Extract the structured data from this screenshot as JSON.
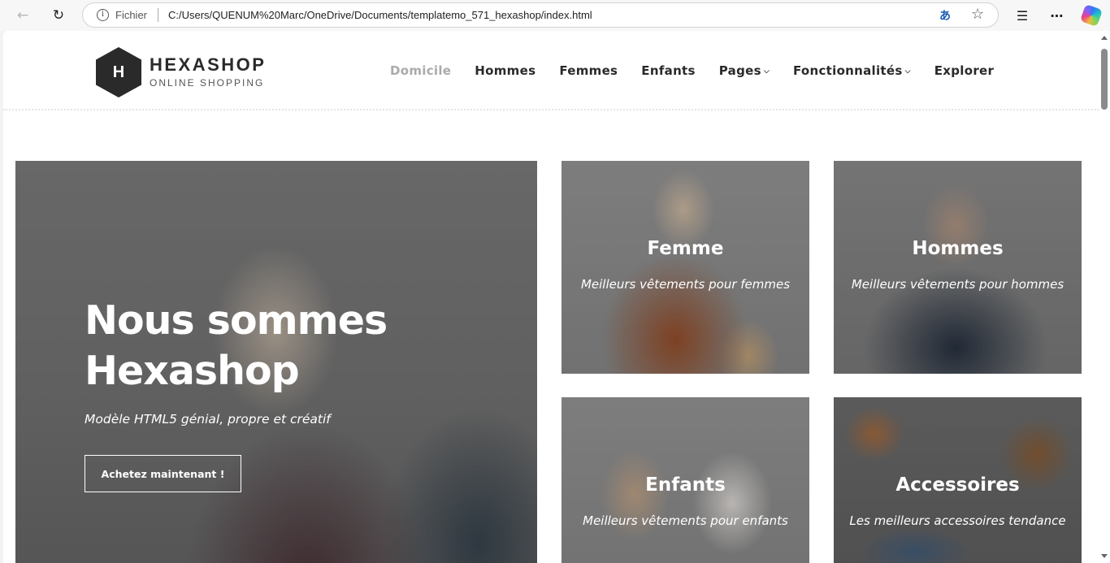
{
  "browser": {
    "scheme_label": "Fichier",
    "url": "C:/Users/QUENUM%20Marc/OneDrive/Documents/templatemo_571_hexashop/index.html",
    "translate_glyph": "ᎃ"
  },
  "site": {
    "logo_letter": "H",
    "logo_name": "HEXASHOP",
    "logo_tagline": "ONLINE SHOPPING"
  },
  "nav": {
    "items": [
      {
        "label": "Domicile",
        "active": true
      },
      {
        "label": "Hommes"
      },
      {
        "label": "Femmes"
      },
      {
        "label": "Enfants"
      },
      {
        "label": "Pages",
        "dropdown": true
      },
      {
        "label": "Fonctionnalités",
        "dropdown": true
      },
      {
        "label": "Explorer"
      }
    ]
  },
  "hero": {
    "title_line1": "Nous sommes",
    "title_line2": "Hexashop",
    "subtitle": "Modèle HTML5 génial, propre et créatif",
    "button": "Achetez maintenant !"
  },
  "categories": [
    {
      "title": "Femme",
      "subtitle": "Meilleurs vêtements pour femmes"
    },
    {
      "title": "Hommes",
      "subtitle": "Meilleurs vêtements pour hommes"
    },
    {
      "title": "Enfants",
      "subtitle": "Meilleurs vêtements pour enfants"
    },
    {
      "title": "Accessoires",
      "subtitle": "Les meilleurs accessoires tendance"
    }
  ],
  "icons": {
    "back": "back-arrow-icon",
    "reload": "reload-icon",
    "info": "info-icon",
    "star": "star-icon",
    "favorites": "favorites-icon",
    "more": "more-icon",
    "copilot": "copilot-icon"
  }
}
